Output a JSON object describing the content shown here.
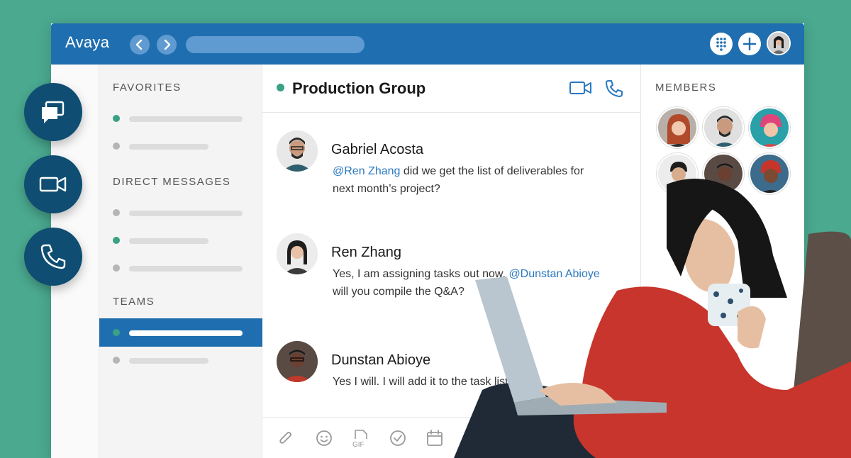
{
  "app": {
    "brand": "Avaya"
  },
  "titlebar": {
    "back_icon": "chevron-left-icon",
    "forward_icon": "chevron-right-icon",
    "right_icons": [
      "dialpad-icon",
      "plus-icon",
      "user-avatar"
    ]
  },
  "sidebar": {
    "sections": [
      {
        "title": "FAVORITES"
      },
      {
        "title": "DIRECT MESSAGES"
      },
      {
        "title": "TEAMS"
      }
    ]
  },
  "chat": {
    "title": "Production Group",
    "messages": [
      {
        "name": "Gabriel Acosta",
        "mention": "@Ren Zhang",
        "text": " did we get the list of deliverables for next month’s project?"
      },
      {
        "name": "Ren Zhang",
        "text": "Yes, I am assigning tasks out now. ",
        "mention": "@Dunstan Abioye",
        "text2": " will you compile the Q&A?"
      },
      {
        "name": "Dunstan Abioye",
        "text": "Yes I will. I will add it to the task list"
      }
    ],
    "composer_icons": [
      "paperclip-icon",
      "emoji-icon",
      "gif-icon",
      "check-circle-icon",
      "calendar-icon"
    ],
    "gif_label": "GIF"
  },
  "members": {
    "title": "MEMBERS"
  },
  "colors": {
    "brand_blue": "#1f6fb0",
    "teal_background": "#4aa98f",
    "fab_navy": "#0f4d72",
    "online_green": "#3aa184",
    "mention_blue": "#2a78bf"
  }
}
